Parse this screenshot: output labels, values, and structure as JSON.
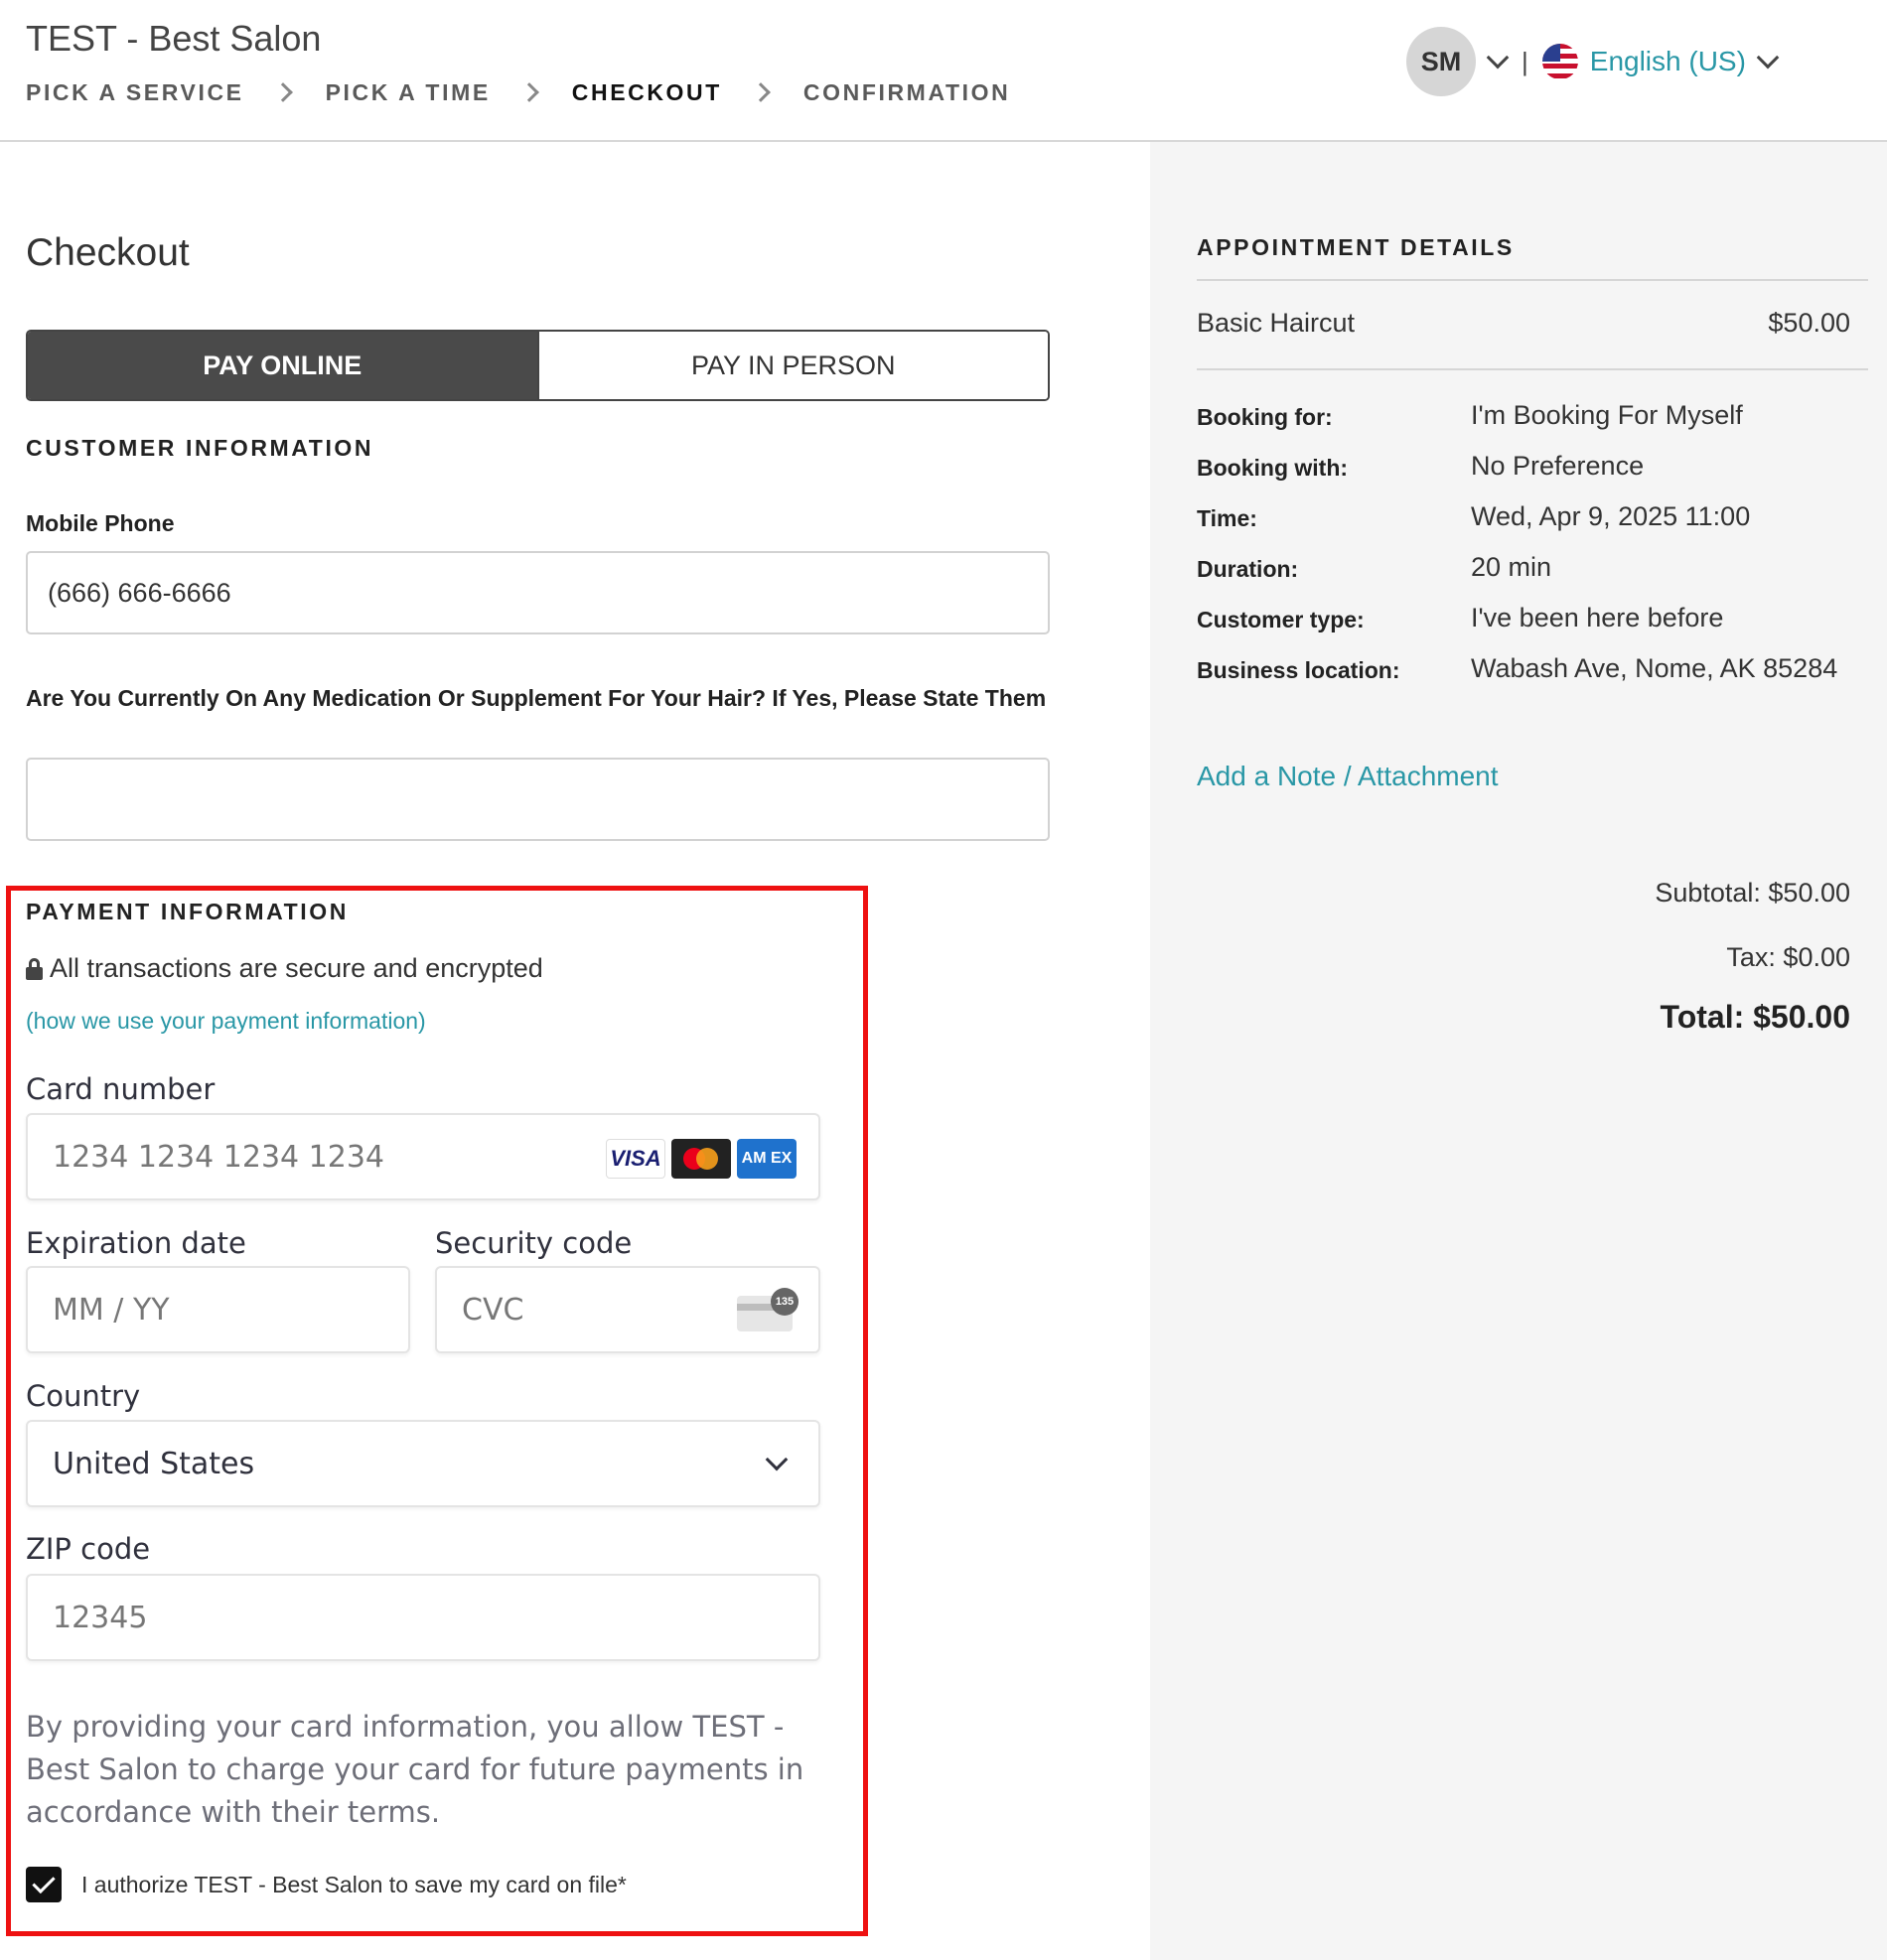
{
  "header": {
    "salon_title": "TEST - Best Salon",
    "breadcrumb": [
      "PICK A SERVICE",
      "PICK A TIME",
      "CHECKOUT",
      "CONFIRMATION"
    ],
    "active_step": "CHECKOUT",
    "avatar_initials": "SM",
    "separator": "|",
    "language": "English (US)"
  },
  "checkout": {
    "title": "Checkout",
    "pay_online_label": "PAY ONLINE",
    "pay_in_person_label": "PAY IN PERSON",
    "customer_info_title": "CUSTOMER INFORMATION",
    "mobile_phone_label": "Mobile Phone",
    "mobile_phone_value": "(666) 666-6666",
    "medication_label": "Are You Currently On Any Medication Or Supplement For Your Hair? If Yes, Please State Them",
    "medication_value": ""
  },
  "payment": {
    "title": "PAYMENT INFORMATION",
    "secure_text": "All transactions are secure and encrypted",
    "info_link": "(how we use your payment information)",
    "card_number_label": "Card number",
    "card_number_placeholder": "1234 1234 1234 1234",
    "brands": [
      "VISA",
      "AM EX"
    ],
    "cvc_badge": "135",
    "expiration_label": "Expiration date",
    "expiration_placeholder": "MM / YY",
    "security_label": "Security code",
    "security_placeholder": "CVC",
    "country_label": "Country",
    "country_value": "United States",
    "zip_label": "ZIP code",
    "zip_placeholder": "12345",
    "terms": "By providing your card information, you allow TEST - Best Salon to charge your card for future payments in accordance with their terms.",
    "authorize_text": "I authorize TEST - Best Salon to save my card on file*",
    "authorize_checked": true
  },
  "appointment": {
    "title": "APPOINTMENT DETAILS",
    "service_name": "Basic Haircut",
    "service_price": "$50.00",
    "details": [
      {
        "label": "Booking for:",
        "value": "I'm Booking For Myself"
      },
      {
        "label": "Booking with:",
        "value": "No Preference"
      },
      {
        "label": "Time:",
        "value": "Wed, Apr 9, 2025 11:00"
      },
      {
        "label": "Duration:",
        "value": "20 min"
      },
      {
        "label": "Customer type:",
        "value": "I've been here before"
      },
      {
        "label": "Business location:",
        "value": "Wabash Ave, Nome, AK 85284"
      }
    ],
    "add_note_link": "Add a Note / Attachment",
    "subtotal": "Subtotal: $50.00",
    "tax": "Tax: $0.00",
    "total": "Total: $50.00"
  },
  "colors": {
    "accent": "#2997a6",
    "highlight_border": "#ee1111",
    "toggle_active": "#4a4a4a",
    "sidebar_bg": "#f5f5f5"
  }
}
